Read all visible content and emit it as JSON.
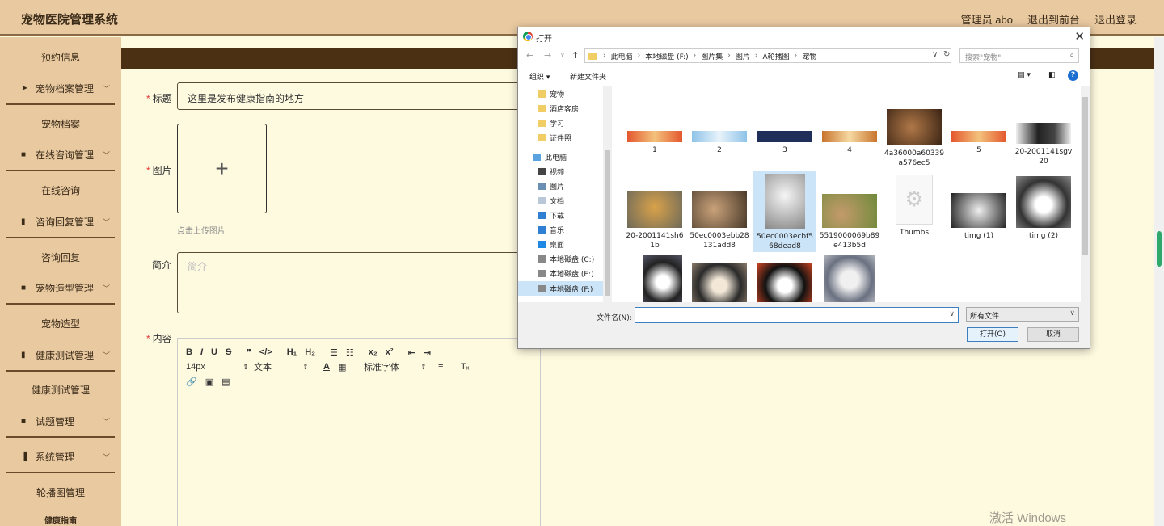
{
  "app": {
    "title": "宠物医院管理系统",
    "user": "管理员 abo",
    "back_to_front": "退出到前台",
    "logout": "退出登录"
  },
  "sidebar": {
    "items": [
      {
        "label": "预约信息",
        "type": "sub"
      },
      {
        "label": "宠物档案管理",
        "type": "menu",
        "icon": "send-icon"
      },
      {
        "label": "宠物档案",
        "type": "sub"
      },
      {
        "label": "在线咨询管理",
        "type": "menu",
        "icon": "grid-icon"
      },
      {
        "label": "在线咨询",
        "type": "sub"
      },
      {
        "label": "咨询回复管理",
        "type": "menu",
        "icon": "doc-icon"
      },
      {
        "label": "咨询回复",
        "type": "sub"
      },
      {
        "label": "宠物造型管理",
        "type": "menu",
        "icon": "grid-icon"
      },
      {
        "label": "宠物造型",
        "type": "sub"
      },
      {
        "label": "健康测试管理",
        "type": "menu",
        "icon": "doc-icon"
      },
      {
        "label": "健康测试管理",
        "type": "sub"
      },
      {
        "label": "试题管理",
        "type": "menu",
        "icon": "grid-icon"
      },
      {
        "label": "系统管理",
        "type": "menu",
        "icon": "chart-icon"
      },
      {
        "label": "轮播图管理",
        "type": "sub"
      },
      {
        "label": "健康指南",
        "type": "sub"
      }
    ]
  },
  "form": {
    "title_label": "标题",
    "title_value": "这里是发布健康指南的地方",
    "image_label": "图片",
    "upload_tip": "点击上传图片",
    "intro_label": "简介",
    "intro_placeholder": "简介",
    "content_label": "内容",
    "editor": {
      "font_size": "14px",
      "text_style": "文本",
      "font_family": "标准字体"
    }
  },
  "dialog": {
    "title": "打开",
    "breadcrumb": [
      "此电脑",
      "本地磁盘 (F:)",
      "图片集",
      "图片",
      "A轮播图",
      "宠物"
    ],
    "search_placeholder": "搜索\"宠物\"",
    "organize": "组织 ▾",
    "new_folder": "新建文件夹",
    "nav": [
      {
        "label": "宠物",
        "icon": "folder-icon"
      },
      {
        "label": "酒店客房",
        "icon": "folder-icon"
      },
      {
        "label": "学习",
        "icon": "folder-icon"
      },
      {
        "label": "证件照",
        "icon": "folder-icon"
      },
      {
        "label": "此电脑",
        "icon": "pc-icon"
      },
      {
        "label": "视频",
        "icon": "video-icon"
      },
      {
        "label": "图片",
        "icon": "picture-icon"
      },
      {
        "label": "文档",
        "icon": "document-icon"
      },
      {
        "label": "下载",
        "icon": "download-icon"
      },
      {
        "label": "音乐",
        "icon": "music-icon"
      },
      {
        "label": "桌面",
        "icon": "desktop-icon"
      },
      {
        "label": "本地磁盘 (C:)",
        "icon": "drive-icon"
      },
      {
        "label": "本地磁盘 (E:)",
        "icon": "drive-icon"
      },
      {
        "label": "本地磁盘 (F:)",
        "icon": "drive-icon"
      }
    ],
    "files": [
      {
        "name": "1"
      },
      {
        "name": "2"
      },
      {
        "name": "3"
      },
      {
        "name": "4"
      },
      {
        "name": "4a36000a60339 a576ec5"
      },
      {
        "name": "5"
      },
      {
        "name": "20-2001141sgv 20"
      },
      {
        "name": "20-2001141sh6 1b"
      },
      {
        "name": "50ec0003ebb28 131add8"
      },
      {
        "name": "50ec0003ecbf5 68dead8"
      },
      {
        "name": "5519000069b89 e413b5d"
      },
      {
        "name": "Thumbs"
      },
      {
        "name": "timg (1)"
      },
      {
        "name": "timg (2)"
      },
      {
        "name": ""
      },
      {
        "name": ""
      },
      {
        "name": ""
      },
      {
        "name": ""
      }
    ],
    "filename_label": "文件名(N):",
    "filetype": "所有文件",
    "open_button": "打开(O)",
    "cancel_button": "取消"
  },
  "watermark": "激活 Windows",
  "colors": {
    "header_bg": "#e8c9a0",
    "band": "#4b3014",
    "page_bg": "#fefae0",
    "accent_green": "#2ea86b"
  }
}
